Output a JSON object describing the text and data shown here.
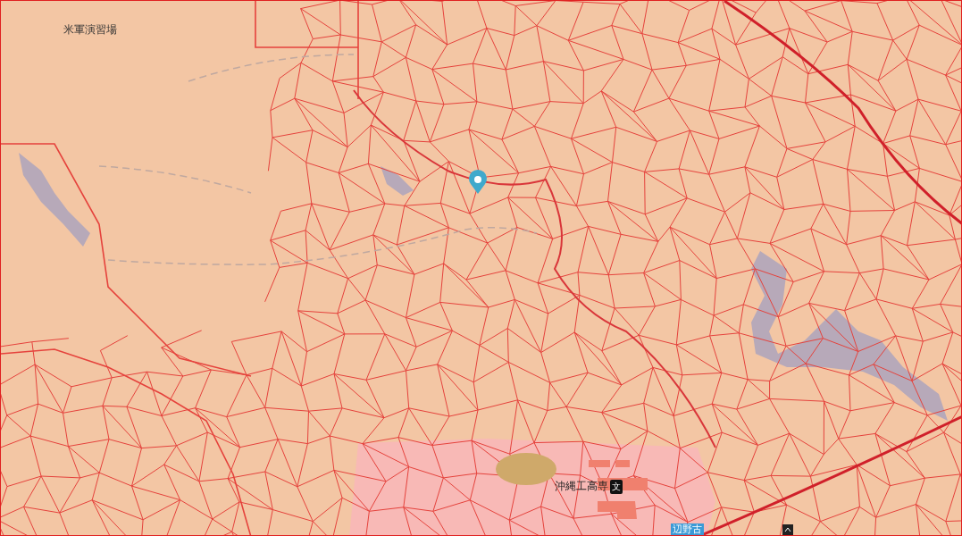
{
  "map": {
    "labels": [
      {
        "kind": "area",
        "text": "米軍演習場"
      },
      {
        "kind": "poi",
        "text": "沖縄工高専",
        "icon": "文"
      },
      {
        "kind": "station",
        "text": "辺野古"
      }
    ]
  }
}
